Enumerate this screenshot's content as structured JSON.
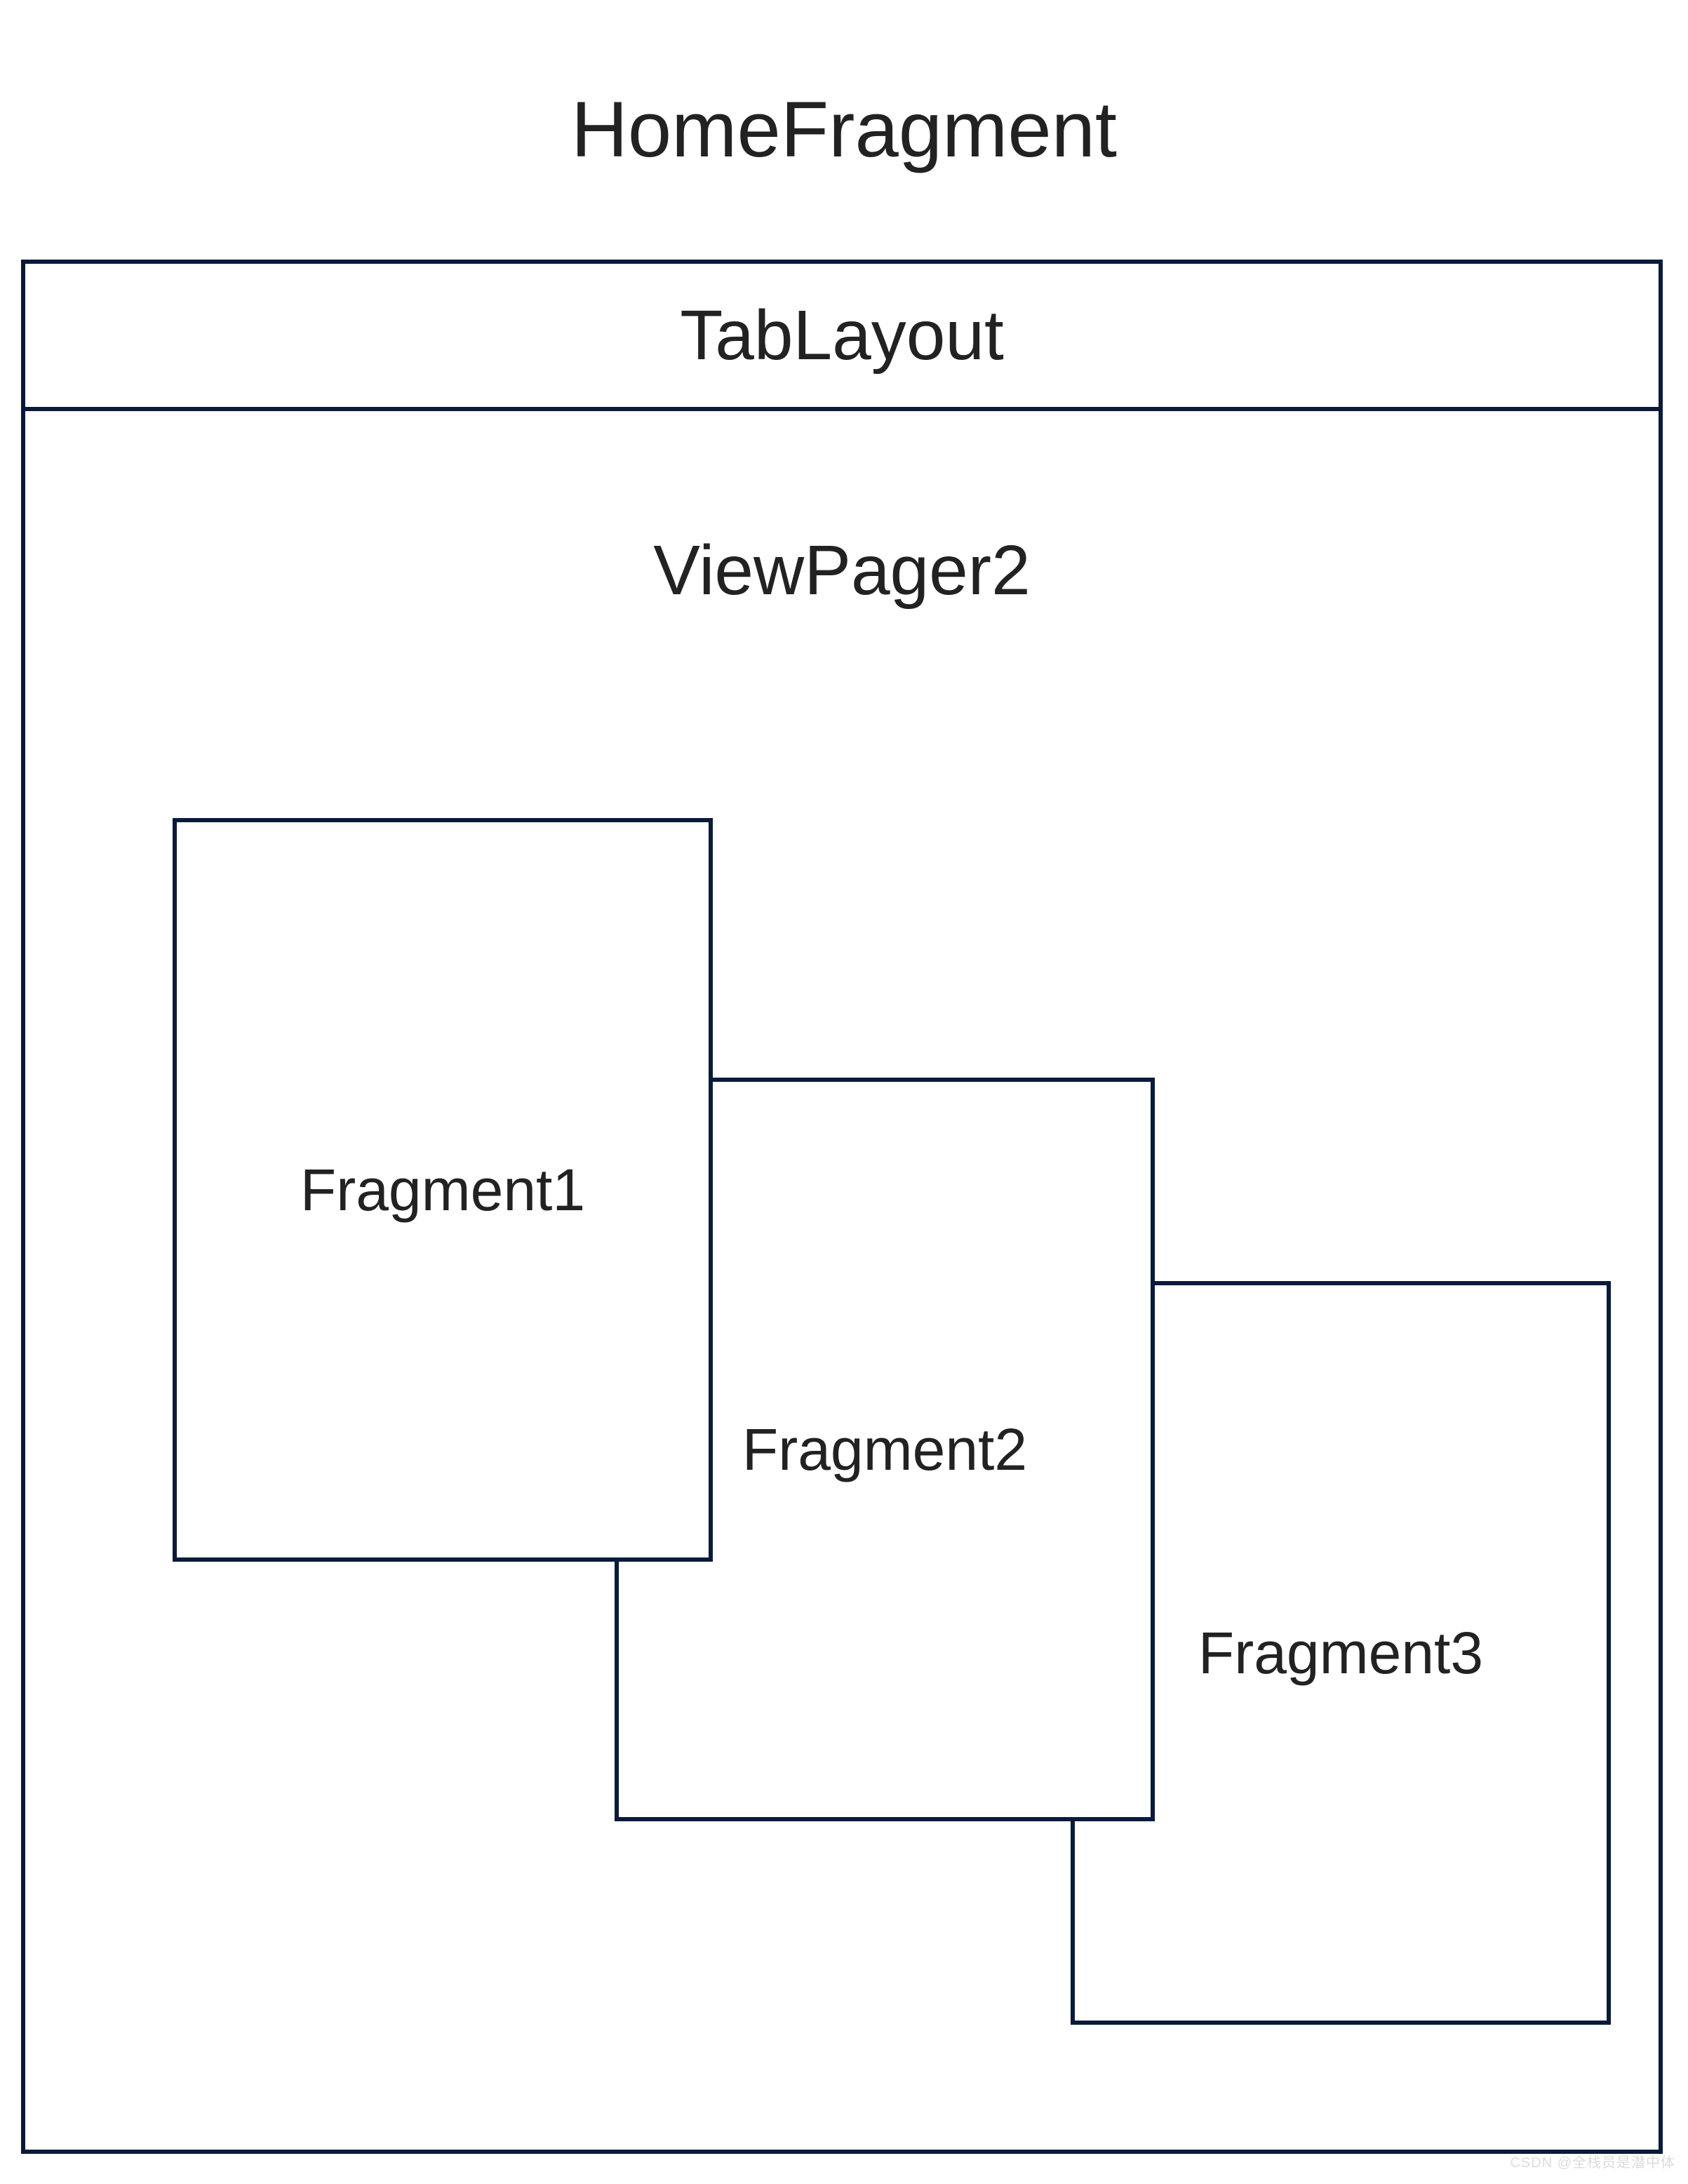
{
  "title": "HomeFragment",
  "tablayout_label": "TabLayout",
  "viewpager_label": "ViewPager2",
  "fragments": {
    "f1": "Fragment1",
    "f2": "Fragment2",
    "f3": "Fragment3"
  },
  "watermark": "CSDN @全栈员是潜中体"
}
